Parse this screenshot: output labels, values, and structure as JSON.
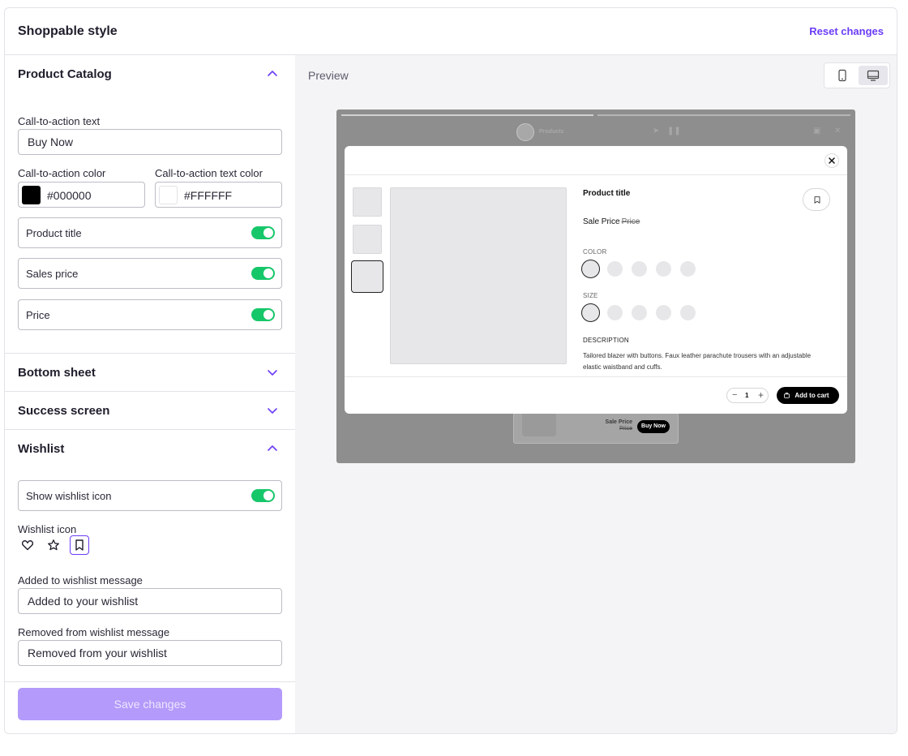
{
  "header": {
    "title": "Shoppable style",
    "reset_label": "Reset changes"
  },
  "sections": {
    "product_catalog": {
      "title": "Product Catalog",
      "expanded": true,
      "cta_text_label": "Call-to-action text",
      "cta_text_value": "Buy Now",
      "cta_color_label": "Call-to-action color",
      "cta_color_value": "#000000",
      "cta_text_color_label": "Call-to-action text color",
      "cta_text_color_value": "#FFFFFF",
      "toggles": [
        {
          "label": "Product title",
          "on": true
        },
        {
          "label": "Sales price",
          "on": true
        },
        {
          "label": "Price",
          "on": true
        }
      ]
    },
    "bottom_sheet": {
      "title": "Bottom sheet",
      "expanded": false
    },
    "success_screen": {
      "title": "Success screen",
      "expanded": false
    },
    "wishlist": {
      "title": "Wishlist",
      "expanded": true,
      "show_icon_label": "Show wishlist icon",
      "show_icon_on": true,
      "icon_label": "Wishlist icon",
      "icon_options": [
        "heart-icon",
        "star-icon",
        "bookmark-icon"
      ],
      "selected_icon": "bookmark-icon",
      "added_label": "Added to wishlist message",
      "added_value": "Added to your wishlist",
      "removed_label": "Removed from wishlist message",
      "removed_value": "Removed from your wishlist"
    }
  },
  "save_label": "Save changes",
  "preview": {
    "label": "Preview",
    "devices": [
      "mobile-icon",
      "desktop-icon"
    ],
    "active_device": "desktop-icon",
    "underlay": {
      "products_label": "Products",
      "sale_price": "Sale Price",
      "price": "Price",
      "buy_label": "Buy Now"
    },
    "modal": {
      "product_title": "Product title",
      "sale_price": "Sale Price",
      "price": "Price",
      "color_label": "COLOR",
      "size_label": "SIZE",
      "description_label": "DESCRIPTION",
      "description": "Tailored blazer with buttons. Faux leather parachute trousers with an adjustable elastic waistband and cuffs.",
      "quantity": "1",
      "add_to_cart": "Add to cart"
    }
  },
  "colors": {
    "accent": "#6b3cf6",
    "toggle_on": "#16c76a",
    "save_disabled": "#b49afa"
  }
}
